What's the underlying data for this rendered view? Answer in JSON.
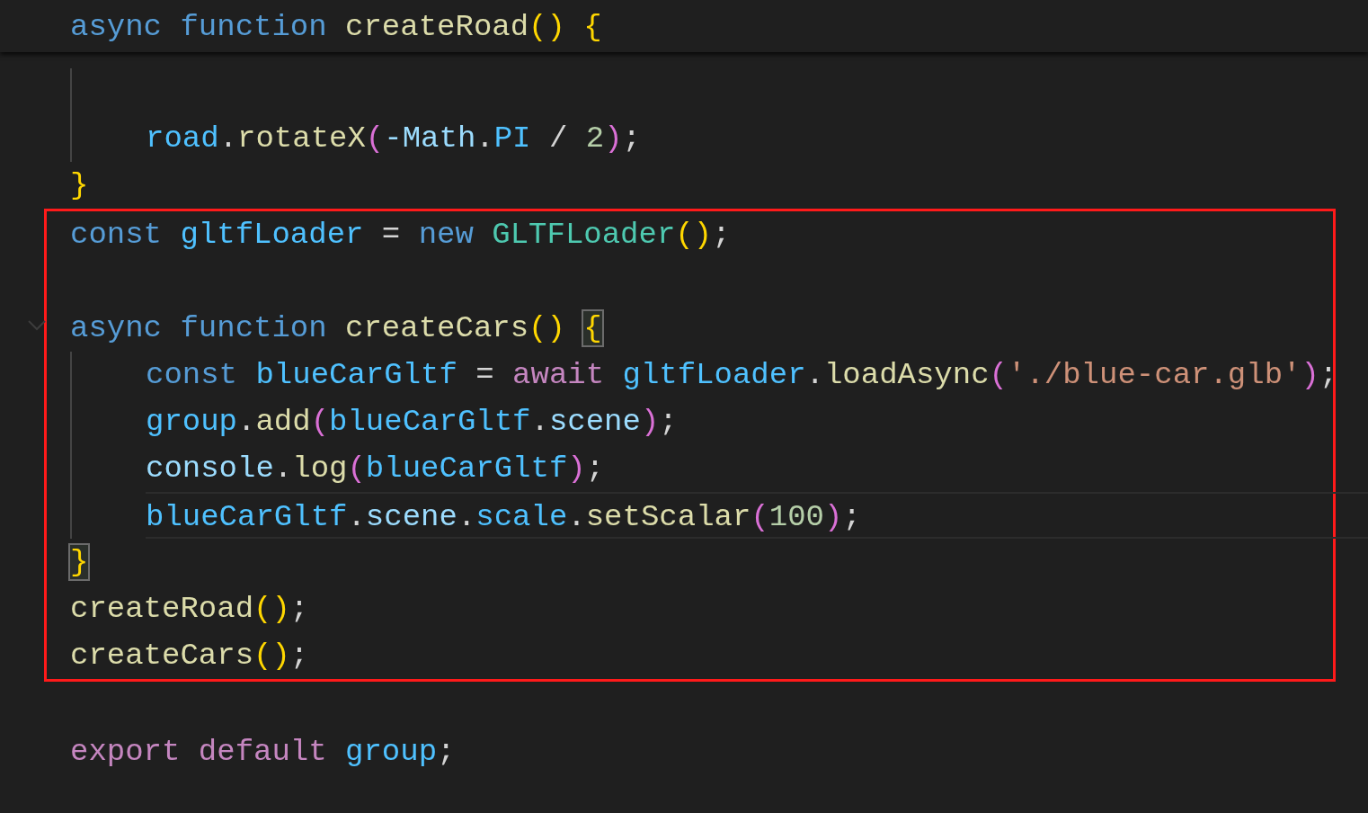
{
  "sticky_header": {
    "tokens": [
      {
        "text": "async ",
        "kind": "keyword"
      },
      {
        "text": "function ",
        "kind": "keyword"
      },
      {
        "text": "createRoad",
        "kind": "func"
      },
      {
        "text": "() ",
        "kind": "bracket1"
      },
      {
        "text": "{",
        "kind": "bracket1"
      }
    ]
  },
  "code": [
    {
      "kind": "block",
      "children": [
        {
          "kind": "blank"
        },
        {
          "kind": "line",
          "tokens": [
            {
              "text": "road",
              "kind": "var"
            },
            {
              "text": ".",
              "kind": "punct"
            },
            {
              "text": "rotateX",
              "kind": "func"
            },
            {
              "text": "(",
              "kind": "bracket2"
            },
            {
              "text": "-Math",
              "kind": "prop"
            },
            {
              "text": ".",
              "kind": "punct"
            },
            {
              "text": "PI ",
              "kind": "var"
            },
            {
              "text": "/ ",
              "kind": "punct"
            },
            {
              "text": "2",
              "kind": "number"
            },
            {
              "text": ")",
              "kind": "bracket2"
            },
            {
              "text": ";",
              "kind": "punct"
            }
          ]
        }
      ]
    },
    {
      "kind": "line",
      "tokens": [
        {
          "text": "}",
          "kind": "bracket1"
        }
      ]
    },
    {
      "kind": "highlight",
      "children": [
        {
          "kind": "line",
          "tokens": [
            {
              "text": "const ",
              "kind": "keyword"
            },
            {
              "text": "gltfLoader ",
              "kind": "var"
            },
            {
              "text": "= ",
              "kind": "punct"
            },
            {
              "text": "new ",
              "kind": "keyword"
            },
            {
              "text": "GLTFLoader",
              "kind": "class"
            },
            {
              "text": "()",
              "kind": "bracket1"
            },
            {
              "text": ";",
              "kind": "punct"
            }
          ]
        },
        {
          "kind": "blank"
        },
        {
          "kind": "line",
          "fold_marker": true,
          "tokens": [
            {
              "text": "async ",
              "kind": "keyword"
            },
            {
              "text": "function ",
              "kind": "keyword"
            },
            {
              "text": "createCars",
              "kind": "func"
            },
            {
              "text": "() ",
              "kind": "bracket1"
            },
            {
              "text": "{",
              "kind": "bracket1",
              "matched": true
            }
          ]
        },
        {
          "kind": "block",
          "children": [
            {
              "kind": "line",
              "tokens": [
                {
                  "text": "const ",
                  "kind": "keyword"
                },
                {
                  "text": "blueCarGltf ",
                  "kind": "var"
                },
                {
                  "text": "= ",
                  "kind": "punct"
                },
                {
                  "text": "await ",
                  "kind": "control"
                },
                {
                  "text": "gltfLoader",
                  "kind": "var"
                },
                {
                  "text": ".",
                  "kind": "punct"
                },
                {
                  "text": "loadAsync",
                  "kind": "func"
                },
                {
                  "text": "(",
                  "kind": "bracket2"
                },
                {
                  "text": "'./blue-car.glb'",
                  "kind": "string"
                },
                {
                  "text": ")",
                  "kind": "bracket2"
                },
                {
                  "text": ";",
                  "kind": "punct"
                }
              ]
            },
            {
              "kind": "line",
              "tokens": [
                {
                  "text": "group",
                  "kind": "var"
                },
                {
                  "text": ".",
                  "kind": "punct"
                },
                {
                  "text": "add",
                  "kind": "func"
                },
                {
                  "text": "(",
                  "kind": "bracket2"
                },
                {
                  "text": "blueCarGltf",
                  "kind": "var"
                },
                {
                  "text": ".",
                  "kind": "punct"
                },
                {
                  "text": "scene",
                  "kind": "prop"
                },
                {
                  "text": ")",
                  "kind": "bracket2"
                },
                {
                  "text": ";",
                  "kind": "punct"
                }
              ]
            },
            {
              "kind": "line",
              "tokens": [
                {
                  "text": "console",
                  "kind": "prop"
                },
                {
                  "text": ".",
                  "kind": "punct"
                },
                {
                  "text": "log",
                  "kind": "func"
                },
                {
                  "text": "(",
                  "kind": "bracket2"
                },
                {
                  "text": "blueCarGltf",
                  "kind": "var"
                },
                {
                  "text": ")",
                  "kind": "bracket2"
                },
                {
                  "text": ";",
                  "kind": "punct"
                }
              ]
            },
            {
              "kind": "line",
              "current": true,
              "tokens": [
                {
                  "text": "blueCarGltf",
                  "kind": "var"
                },
                {
                  "text": ".",
                  "kind": "punct"
                },
                {
                  "text": "scene",
                  "kind": "prop"
                },
                {
                  "text": ".",
                  "kind": "punct"
                },
                {
                  "text": "scale",
                  "kind": "var"
                },
                {
                  "text": ".",
                  "kind": "punct"
                },
                {
                  "text": "setScalar",
                  "kind": "func"
                },
                {
                  "text": "(",
                  "kind": "bracket2"
                },
                {
                  "text": "100",
                  "kind": "number"
                },
                {
                  "text": ")",
                  "kind": "bracket2"
                },
                {
                  "text": ";",
                  "kind": "punct"
                }
              ]
            }
          ]
        },
        {
          "kind": "line",
          "tokens": [
            {
              "text": "}",
              "kind": "bracket1",
              "matched": true
            }
          ]
        },
        {
          "kind": "line",
          "tokens": [
            {
              "text": "createRoad",
              "kind": "func"
            },
            {
              "text": "()",
              "kind": "bracket1"
            },
            {
              "text": ";",
              "kind": "punct"
            }
          ]
        },
        {
          "kind": "line",
          "tokens": [
            {
              "text": "createCars",
              "kind": "func"
            },
            {
              "text": "()",
              "kind": "bracket1"
            },
            {
              "text": ";",
              "kind": "punct"
            }
          ]
        }
      ]
    },
    {
      "kind": "blank"
    },
    {
      "kind": "line",
      "tokens": [
        {
          "text": "export ",
          "kind": "control"
        },
        {
          "text": "default ",
          "kind": "control"
        },
        {
          "text": "group",
          "kind": "var"
        },
        {
          "text": ";",
          "kind": "punct"
        }
      ]
    }
  ]
}
